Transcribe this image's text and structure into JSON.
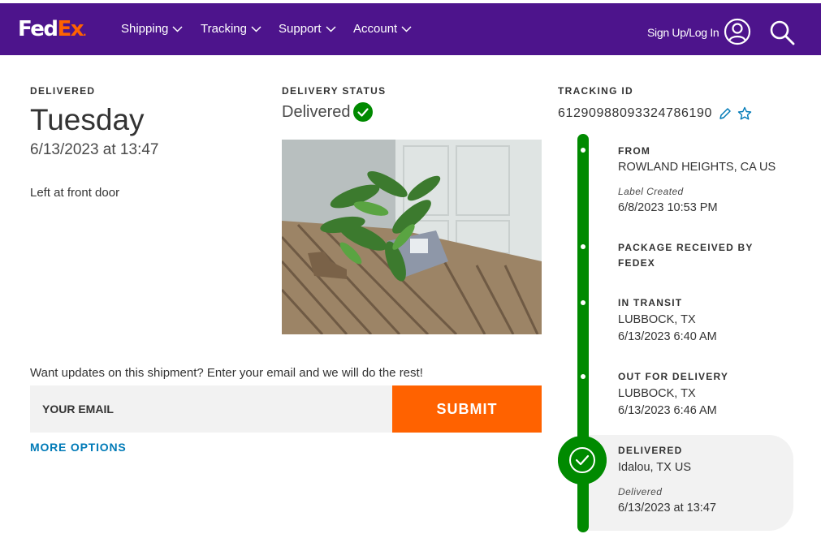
{
  "header": {
    "logo_fed": "Fed",
    "logo_ex": "Ex",
    "logo_dot": ".",
    "nav": [
      "Shipping",
      "Tracking",
      "Support",
      "Account"
    ],
    "sign_in": "Sign Up/Log In",
    "brand_color": "#4d148c",
    "accent_color": "#ff6200"
  },
  "delivery": {
    "label": "DELIVERED",
    "day": "Tuesday",
    "datetime": "6/13/2023 at 13:47",
    "note": "Left at front door"
  },
  "status": {
    "label": "DELIVERY STATUS",
    "value": "Delivered",
    "photo_description": "delivery-proof-photo"
  },
  "updates": {
    "prompt": "Want updates on this shipment? Enter your email and we will do the rest!",
    "email_placeholder": "YOUR EMAIL",
    "submit_label": "SUBMIT",
    "more_options": "MORE OPTIONS"
  },
  "tracking": {
    "label": "TRACKING ID",
    "id": "612909880933247861​90"
  },
  "timeline": [
    {
      "title": "FROM",
      "line1": "ROWLAND HEIGHTS, CA US",
      "italic": "Label Created",
      "line2": "6/8/2023 10:53 PM"
    },
    {
      "title": "PACKAGE RECEIVED BY",
      "title2": "FEDEX"
    },
    {
      "title": "IN TRANSIT",
      "line1": "LUBBOCK, TX",
      "line2": "6/13/2023 6:40 AM"
    },
    {
      "title": "OUT FOR DELIVERY",
      "line1": "LUBBOCK, TX",
      "line2": "6/13/2023 6:46 AM"
    },
    {
      "title": "DELIVERED",
      "line1": "Idalou, TX US",
      "italic": "Delivered",
      "line2": "6/13/2023 at 13:47"
    }
  ],
  "colors": {
    "status_green": "#008a00",
    "link_blue": "#007ab7",
    "submit_orange": "#ff6200"
  }
}
